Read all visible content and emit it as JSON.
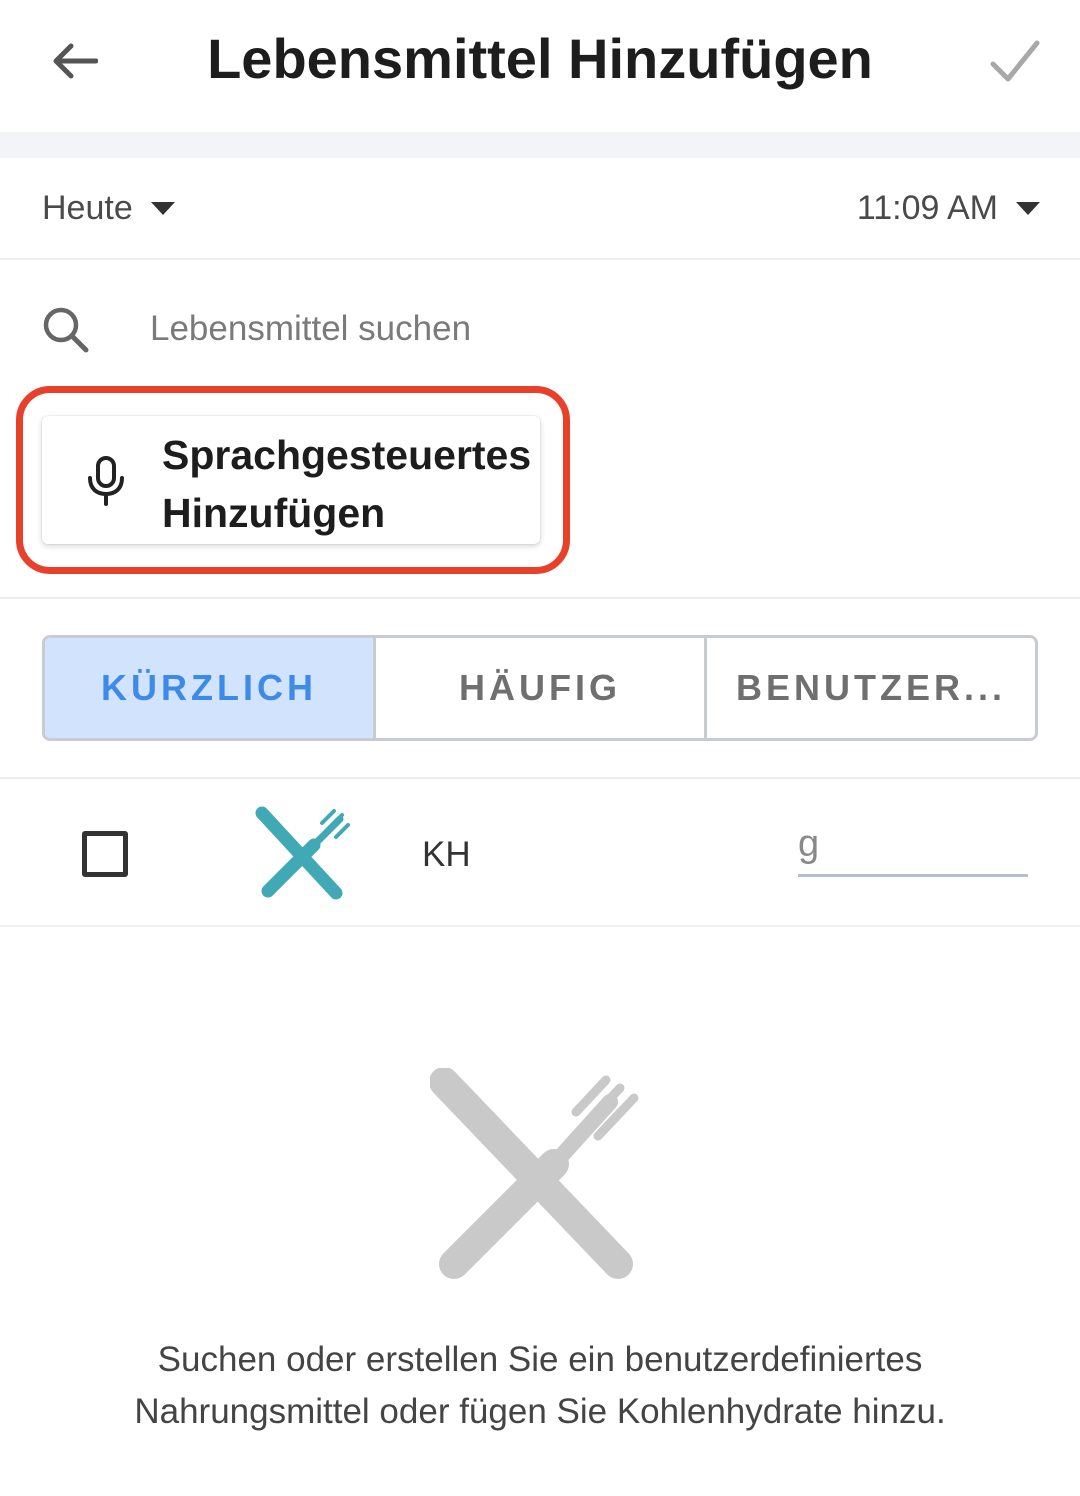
{
  "header": {
    "title": "Lebensmittel Hinzufügen",
    "back_icon": "arrow-left-icon",
    "confirm_icon": "check-icon"
  },
  "datetime": {
    "date": "Heute",
    "time": "11:09 AM"
  },
  "search": {
    "placeholder": "Lebensmittel suchen",
    "value": ""
  },
  "voice_add": {
    "label": "Sprachgesteuertes Hinzufügen",
    "icon": "microphone-icon"
  },
  "tabs": [
    {
      "label": "KÜRZLICH",
      "active": true
    },
    {
      "label": "HÄUFIG",
      "active": false
    },
    {
      "label": "BENUTZER...",
      "active": false
    }
  ],
  "carb_entry": {
    "label": "KH",
    "unit": "g",
    "checked": false,
    "icon": "knife-fork-icon"
  },
  "empty_state": {
    "message": "Suchen oder erstellen Sie ein benutzerdefiniertes Nahrungsmittel oder fügen Sie Kohlenhydrate hinzu.",
    "icon": "knife-fork-icon"
  },
  "colors": {
    "accent": "#3d8ae8",
    "tab_active_bg": "#d2e4fd",
    "carb_icon": "#41a9b5",
    "highlight": "#e8402a"
  }
}
